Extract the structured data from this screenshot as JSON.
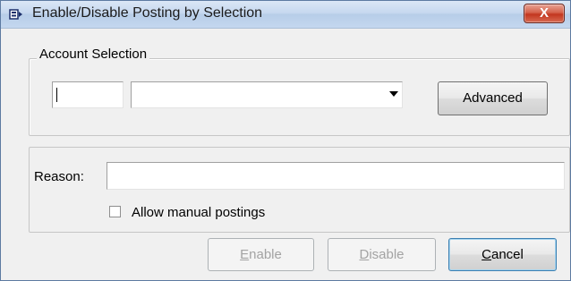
{
  "window": {
    "title": "Enable/Disable Posting by Selection",
    "close_label": "X"
  },
  "account_selection": {
    "legend": "Account Selection",
    "code_value": "",
    "select_value": "",
    "advanced_label": "Advanced"
  },
  "reason": {
    "label": "Reason:",
    "value": ""
  },
  "allow_manual": {
    "label": "Allow manual postings",
    "checked": false
  },
  "buttons": {
    "enable": {
      "first": "E",
      "rest": "nable",
      "enabled": false
    },
    "disable": {
      "first": "D",
      "rest": "isable",
      "enabled": false
    },
    "cancel": {
      "first": "C",
      "rest": "ancel",
      "enabled": true
    }
  }
}
